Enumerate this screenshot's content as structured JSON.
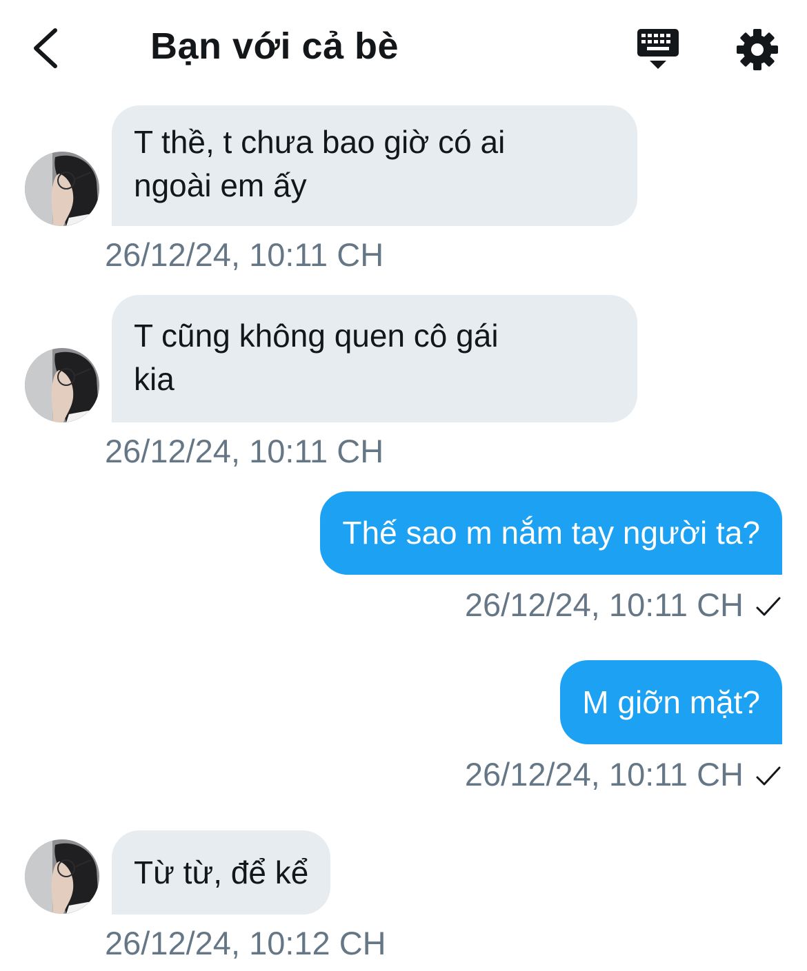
{
  "header": {
    "title": "Bạn với cả bè"
  },
  "messages": [
    {
      "text": "T thề, t chưa bao giờ có ai\nngoài em ấy",
      "time": "26/12/24, 10:11 CH"
    },
    {
      "text": "T cũng không quen cô gái\nkia",
      "time": "26/12/24, 10:11 CH"
    },
    {
      "text": "Thế sao m nắm tay người ta?",
      "time": "26/12/24, 10:11 CH"
    },
    {
      "text": "M giỡn mặt?",
      "time": "26/12/24, 10:11 CH"
    },
    {
      "text": "Từ từ, để kể",
      "time": "26/12/24, 10:12 CH"
    }
  ],
  "colors": {
    "accent": "#1da1f2",
    "incoming_bubble": "#e6ecf0",
    "timestamp": "#657786"
  },
  "icons": {
    "back": "chevron-left-icon",
    "keyboard": "keyboard-icon",
    "settings": "gear-icon",
    "read_receipt": "checkmark-icon"
  }
}
